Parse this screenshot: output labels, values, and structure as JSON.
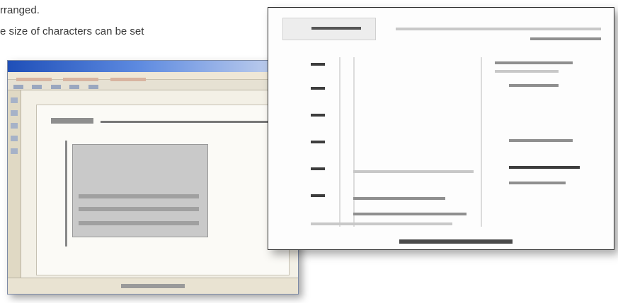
{
  "caption": {
    "line1": "rranged.",
    "line2": "e size of characters can be set"
  }
}
